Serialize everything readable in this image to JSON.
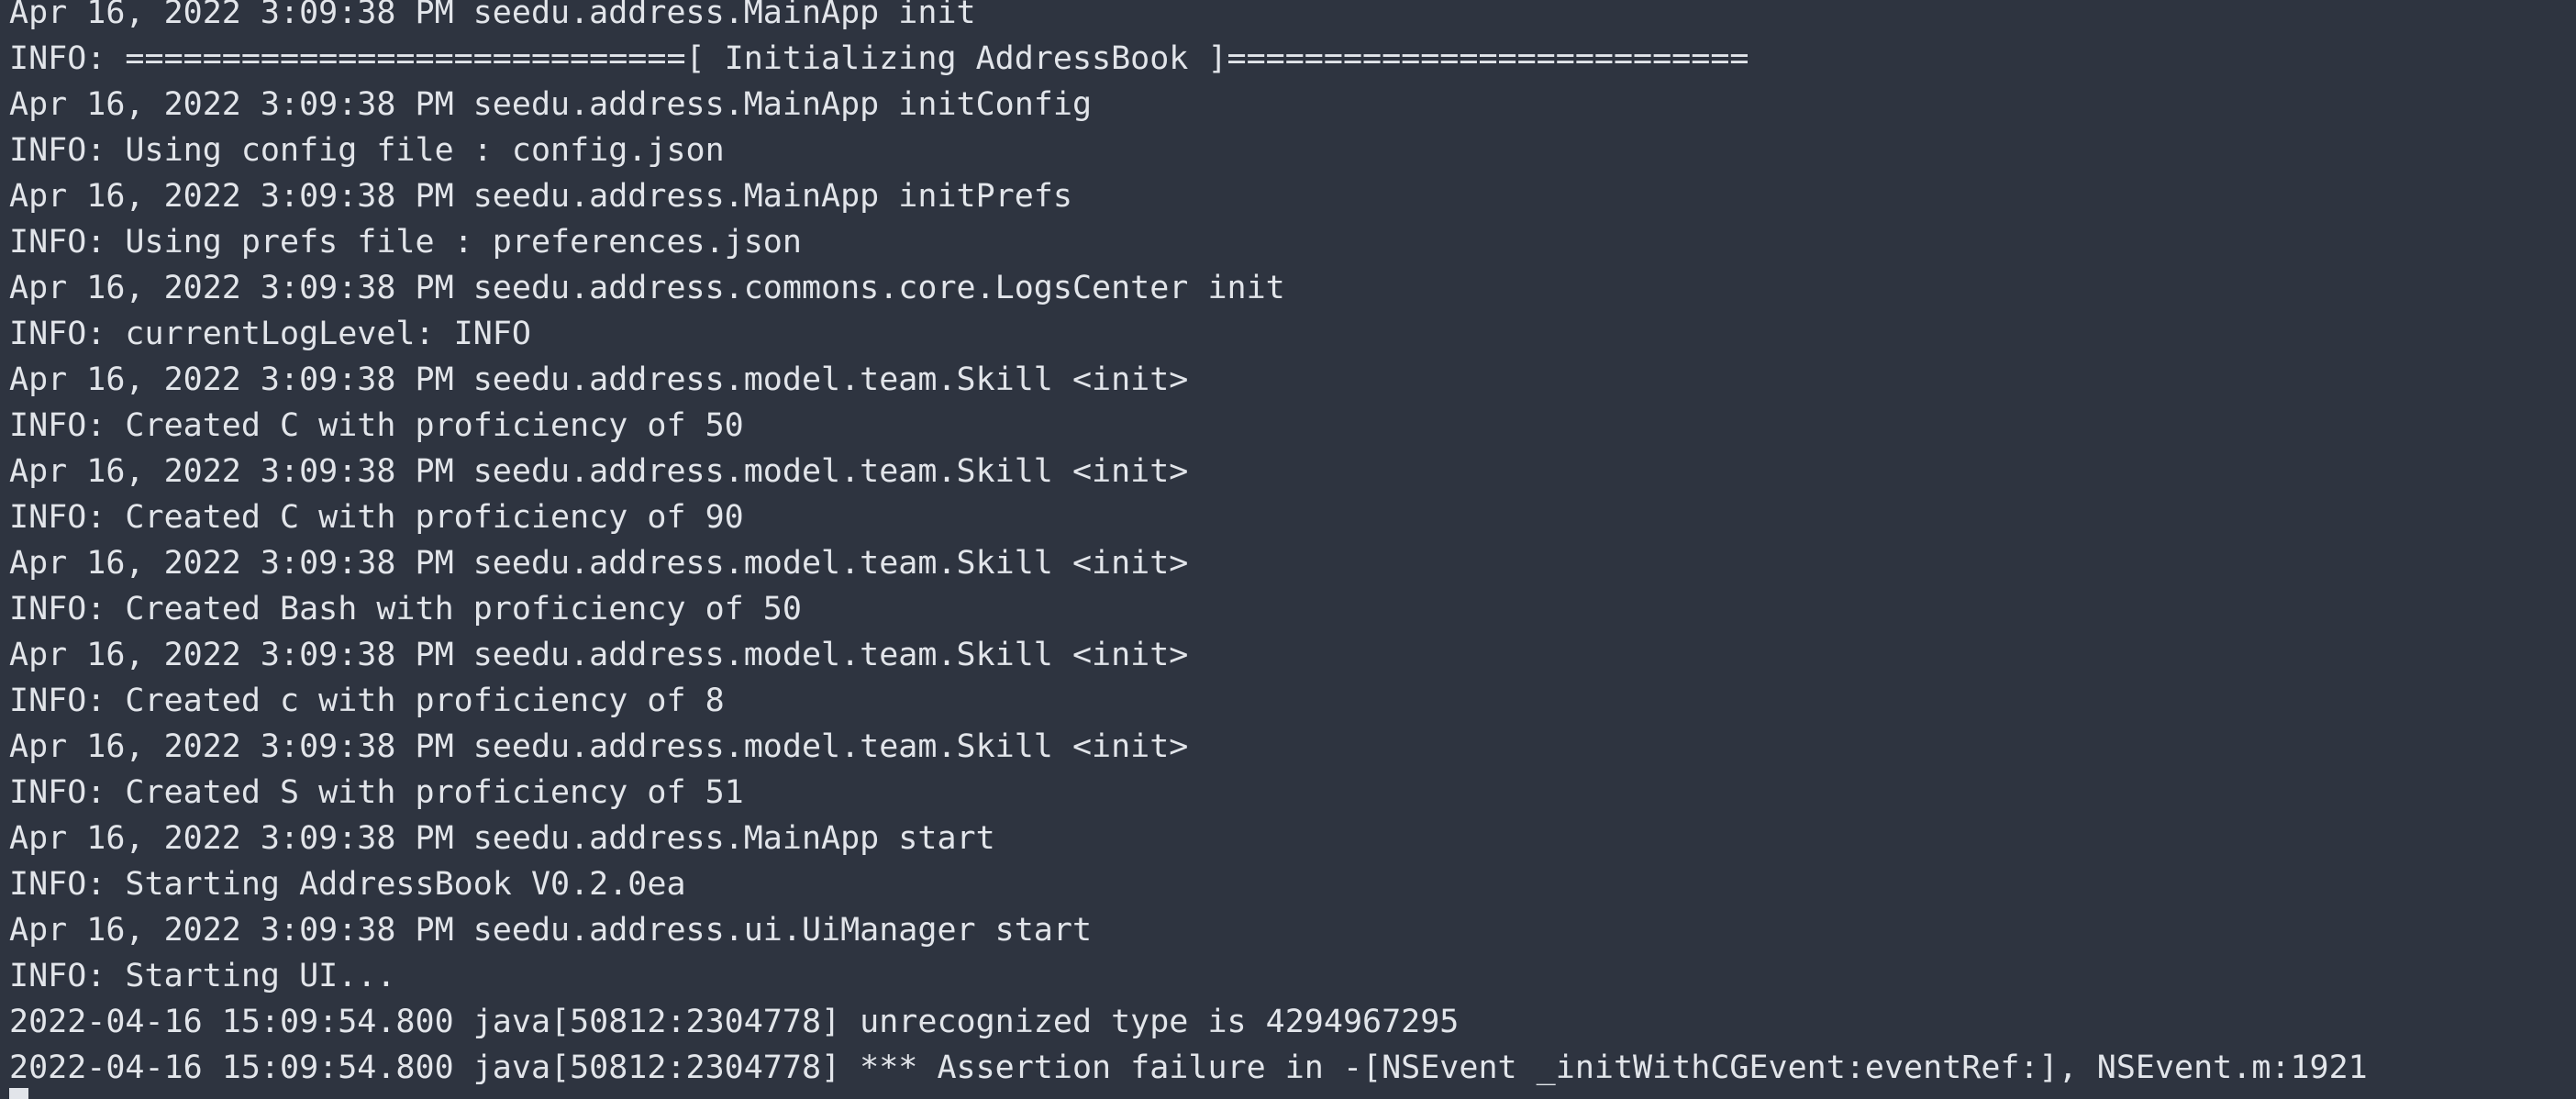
{
  "terminal": {
    "lines": [
      "Apr 16, 2022 3:09:38 PM seedu.address.MainApp init",
      "INFO: =============================[ Initializing AddressBook ]===========================",
      "Apr 16, 2022 3:09:38 PM seedu.address.MainApp initConfig",
      "INFO: Using config file : config.json",
      "Apr 16, 2022 3:09:38 PM seedu.address.MainApp initPrefs",
      "INFO: Using prefs file : preferences.json",
      "Apr 16, 2022 3:09:38 PM seedu.address.commons.core.LogsCenter init",
      "INFO: currentLogLevel: INFO",
      "Apr 16, 2022 3:09:38 PM seedu.address.model.team.Skill <init>",
      "INFO: Created C with proficiency of 50",
      "Apr 16, 2022 3:09:38 PM seedu.address.model.team.Skill <init>",
      "INFO: Created C with proficiency of 90",
      "Apr 16, 2022 3:09:38 PM seedu.address.model.team.Skill <init>",
      "INFO: Created Bash with proficiency of 50",
      "Apr 16, 2022 3:09:38 PM seedu.address.model.team.Skill <init>",
      "INFO: Created c with proficiency of 8",
      "Apr 16, 2022 3:09:38 PM seedu.address.model.team.Skill <init>",
      "INFO: Created S with proficiency of 51",
      "Apr 16, 2022 3:09:38 PM seedu.address.MainApp start",
      "INFO: Starting AddressBook V0.2.0ea",
      "Apr 16, 2022 3:09:38 PM seedu.address.ui.UiManager start",
      "INFO: Starting UI...",
      "2022-04-16 15:09:54.800 java[50812:2304778] unrecognized type is 4294967295",
      "2022-04-16 15:09:54.800 java[50812:2304778] *** Assertion failure in -[NSEvent _initWithCGEvent:eventRef:], NSEvent.m:1921"
    ]
  }
}
